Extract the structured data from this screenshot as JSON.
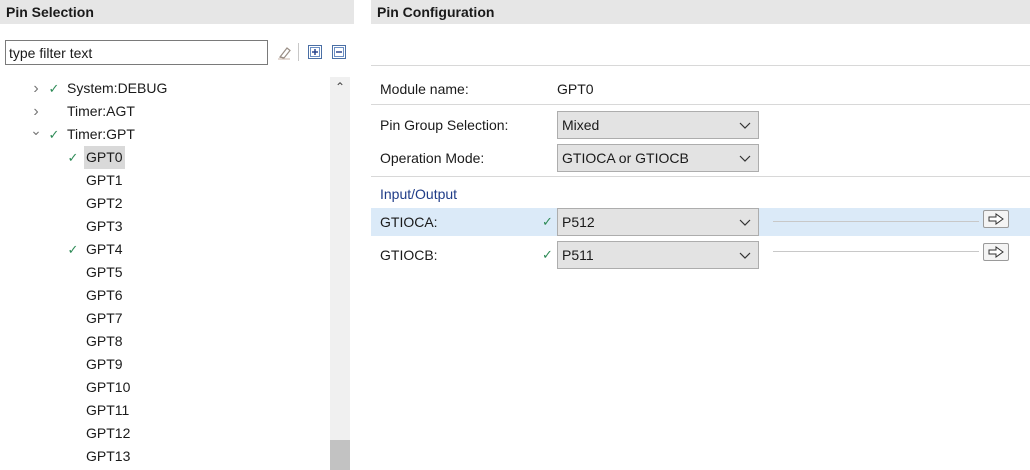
{
  "left_panel": {
    "title": "Pin Selection",
    "filter": {
      "value": "",
      "placeholder": "type filter text"
    },
    "tree": [
      {
        "label": "System:DEBUG",
        "level": 1,
        "twisty": "collapsed",
        "checked": true
      },
      {
        "label": "Timer:AGT",
        "level": 1,
        "twisty": "collapsed",
        "checked": false
      },
      {
        "label": "Timer:GPT",
        "level": 1,
        "twisty": "expanded",
        "checked": true
      },
      {
        "label": "GPT0",
        "level": 2,
        "checked": true,
        "selected": true
      },
      {
        "label": "GPT1",
        "level": 2,
        "checked": false
      },
      {
        "label": "GPT2",
        "level": 2,
        "checked": false
      },
      {
        "label": "GPT3",
        "level": 2,
        "checked": false
      },
      {
        "label": "GPT4",
        "level": 2,
        "checked": true
      },
      {
        "label": "GPT5",
        "level": 2,
        "checked": false
      },
      {
        "label": "GPT6",
        "level": 2,
        "checked": false
      },
      {
        "label": "GPT7",
        "level": 2,
        "checked": false
      },
      {
        "label": "GPT8",
        "level": 2,
        "checked": false
      },
      {
        "label": "GPT9",
        "level": 2,
        "checked": false
      },
      {
        "label": "GPT10",
        "level": 2,
        "checked": false
      },
      {
        "label": "GPT11",
        "level": 2,
        "checked": false
      },
      {
        "label": "GPT12",
        "level": 2,
        "checked": false
      },
      {
        "label": "GPT13",
        "level": 2,
        "checked": false
      }
    ],
    "icons": {
      "clear_filter": "eraser-icon",
      "expand_all": "expand-all-icon",
      "collapse_all": "collapse-all-icon"
    }
  },
  "right_panel": {
    "title": "Pin Configuration",
    "module": {
      "label": "Module name:",
      "value": "GPT0"
    },
    "pin_group": {
      "label": "Pin Group Selection:",
      "value": "Mixed"
    },
    "operation_mode": {
      "label": "Operation Mode:",
      "value": "GTIOCA or GTIOCB"
    },
    "io_section_title": "Input/Output",
    "io": [
      {
        "label": "GTIOCA:",
        "value": "P512",
        "checked": true,
        "highlighted": true
      },
      {
        "label": "GTIOCB:",
        "value": "P511",
        "checked": true,
        "highlighted": false
      }
    ]
  },
  "colors": {
    "check_green": "#2e8b57",
    "section_title_blue": "#1f3c88",
    "row_highlight": "#dbeaf8",
    "header_bg": "#e6e6e6",
    "combo_bg": "#e3e3e3"
  }
}
